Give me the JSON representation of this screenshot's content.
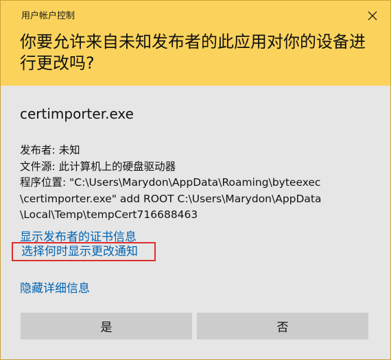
{
  "window": {
    "title": "用户帐户控制",
    "close_icon": "close-icon"
  },
  "header": {
    "question": "你要允许来自未知发布者的此应用对你的设备进行更改吗?",
    "accent_color": "#fbd35c"
  },
  "app": {
    "name": "certimporter.exe"
  },
  "details": {
    "publisher": "发布者: 未知",
    "file_origin": "文件源: 此计算机上的硬盘驱动器",
    "program_location_line1": "程序位置: \"C:\\Users\\Marydon\\AppData\\Roaming\\byteexec",
    "program_location_line2": "\\certimporter.exe\" add ROOT C:\\Users\\Marydon\\AppData",
    "program_location_line3": "\\Local\\Temp\\tempCert716688463"
  },
  "links": {
    "show_certificate": "显示发布者的证书信息",
    "change_notify": "选择何时显示更改通知",
    "hide_details": "隐藏详细信息",
    "link_color": "#0063b1",
    "highlight_color": "#e02b2b"
  },
  "buttons": {
    "yes": "是",
    "no": "否"
  }
}
